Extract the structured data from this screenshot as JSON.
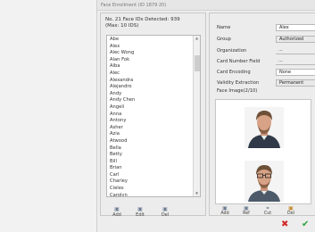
{
  "window": {
    "title": "Face Enrollment (ID 1879 20)"
  },
  "left_panel": {
    "header_line1": "No. 21 Face IDs Detected: 939",
    "header_line2": "(Max: 10 IDS)",
    "names": [
      "Abe",
      "Alex",
      "Alec Wong",
      "Alan Fok",
      "Alba",
      "Alec",
      "Alexandra",
      "Alejandro",
      "Andy",
      "Andy Chen",
      "Angeli",
      "Anna",
      "Antony",
      "Asher",
      "Azia",
      "Atwood",
      "Bella",
      "Betty",
      "Bill",
      "Brian",
      "Carl",
      "Charley",
      "Cieles",
      "Carolyn"
    ],
    "buttons": [
      {
        "label": "Add",
        "icon": "add-icon"
      },
      {
        "label": "Edit",
        "icon": "edit-icon"
      },
      {
        "label": "Del",
        "icon": "delete-icon"
      }
    ]
  },
  "form": {
    "name_label": "Name",
    "name_value": "Alex",
    "group_label": "Group",
    "group_value": "Authorized",
    "organization_label": "Organization",
    "organization_value": "...",
    "card_number_label": "Card Number Field",
    "card_number_value": "...",
    "card_encoding_label": "Card Encoding",
    "card_encoding_value": "None",
    "validity_label": "Validity Extraction",
    "validity_value": "Permanent",
    "face_image_label": "Face Image(2/10)"
  },
  "photo_buttons": [
    {
      "label": "Add",
      "icon": "camera-icon"
    },
    {
      "label": "Ref",
      "icon": "refresh-icon"
    },
    {
      "label": "Cut",
      "icon": "crop-icon"
    },
    {
      "label": "Del",
      "icon": "delete-icon"
    }
  ],
  "colors": {
    "cancel": "#d12b2b",
    "confirm": "#2aa33a"
  }
}
